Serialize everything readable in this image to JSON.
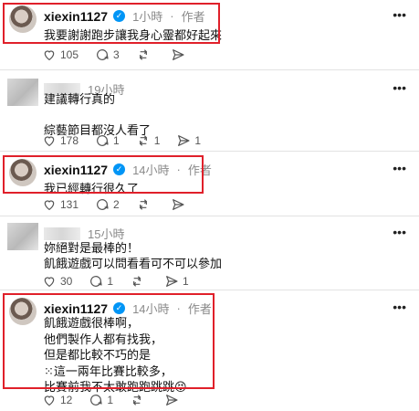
{
  "posts": [
    {
      "username": "xiexin1127",
      "time": "1小時",
      "author_tag": "作者",
      "text": "我要謝謝跑步讓我身心靈都好起來",
      "likes": "105",
      "comments": "3",
      "reposts": "",
      "shares": "",
      "highlighted": true
    },
    {
      "username": "",
      "time": "19小時",
      "author_tag": "",
      "text": "建議轉行真的\n\n綜藝節目都沒人看了",
      "likes": "178",
      "comments": "1",
      "reposts": "1",
      "shares": "1",
      "highlighted": false
    },
    {
      "username": "xiexin1127",
      "time": "14小時",
      "author_tag": "作者",
      "text": "我已經轉行很久了",
      "likes": "131",
      "comments": "2",
      "reposts": "",
      "shares": "",
      "highlighted": true
    },
    {
      "username": "",
      "time": "15小時",
      "author_tag": "",
      "text": "妳絕對是最棒的！\n飢餓遊戲可以問看看可不可以參加",
      "likes": "30",
      "comments": "1",
      "reposts": "",
      "shares": "1",
      "highlighted": false
    },
    {
      "username": "xiexin1127",
      "time": "14小時",
      "author_tag": "作者",
      "text": "飢餓遊戲很棒啊，\n他們製作人都有找我，\n但是都比較不巧的是\n⁙這一兩年比賽比較多，\n比賽前我不太敢跑跑跳跳😝",
      "likes": "12",
      "comments": "1",
      "reposts": "",
      "shares": "",
      "highlighted": true
    }
  ],
  "separator": "·",
  "colors": {
    "highlight_border": "#e0202a",
    "verified": "#0095f6"
  },
  "icons": [
    "verified-icon",
    "more-icon",
    "heart-icon",
    "comment-icon",
    "repost-icon",
    "share-icon"
  ]
}
